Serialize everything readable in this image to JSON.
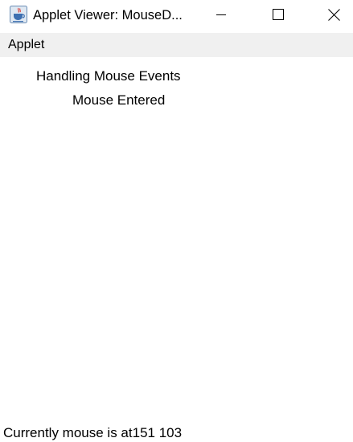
{
  "window": {
    "title": "Applet Viewer: MouseD...",
    "icon": "java-cup-icon",
    "controls": [
      "minimize-icon",
      "maximize-icon",
      "close-icon"
    ]
  },
  "menubar": {
    "items": [
      {
        "label": "Applet"
      }
    ]
  },
  "applet": {
    "heading": "Handling Mouse Events",
    "event_message": "Mouse Entered",
    "status_message": "Currently mouse is at151 103"
  }
}
